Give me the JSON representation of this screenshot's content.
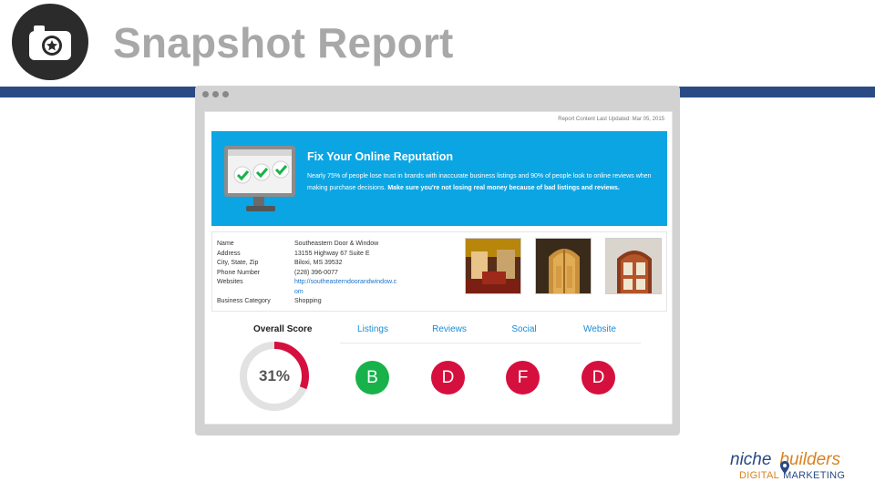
{
  "slide": {
    "title": "Snapshot Report"
  },
  "report": {
    "updated": "Report Content Last Updated: Mar 05, 2015",
    "banner": {
      "title": "Fix Your Online Reputation",
      "text": "Nearly 75% of people lose trust in brands with inaccurate business listings and 90% of people look to online reviews when making purchase decisions.",
      "text_bold": "Make sure you're not losing real money because of bad listings and reviews."
    },
    "business": {
      "rows": [
        {
          "label": "Name",
          "value": "Southeastern Door & Window"
        },
        {
          "label": "Address",
          "value": "13155 Highway 67 Suite E"
        },
        {
          "label": "City, State, Zip",
          "value": "Biloxi, MS  39532"
        },
        {
          "label": "Phone Number",
          "value": "(228) 396-0077"
        },
        {
          "label": "Websites",
          "value": "http://southeasterndoorandwindow.com"
        },
        {
          "label": "Business Category",
          "value": "Shopping"
        }
      ]
    },
    "overall": {
      "label": "Overall Score",
      "value_text": "31%",
      "value": 0.31
    },
    "categories": [
      {
        "label": "Listings",
        "grade": "B",
        "color": "#18b24a"
      },
      {
        "label": "Reviews",
        "grade": "D",
        "color": "#d5103e"
      },
      {
        "label": "Social",
        "grade": "F",
        "color": "#d5103e"
      },
      {
        "label": "Website",
        "grade": "D",
        "color": "#d5103e"
      }
    ]
  },
  "colors": {
    "accent_blue": "#0ba5e4",
    "band": "#2a4a86",
    "gauge_fill": "#d5103e",
    "gauge_track": "#e2e2e2"
  },
  "icons": {
    "header": "camera-star-icon",
    "banner": "monitor-checkmarks-icon"
  },
  "logo": {
    "top_a": "niche",
    "top_b": "builders",
    "bottom_a": "DIGITAL",
    "bottom_b": "MARKETING"
  }
}
